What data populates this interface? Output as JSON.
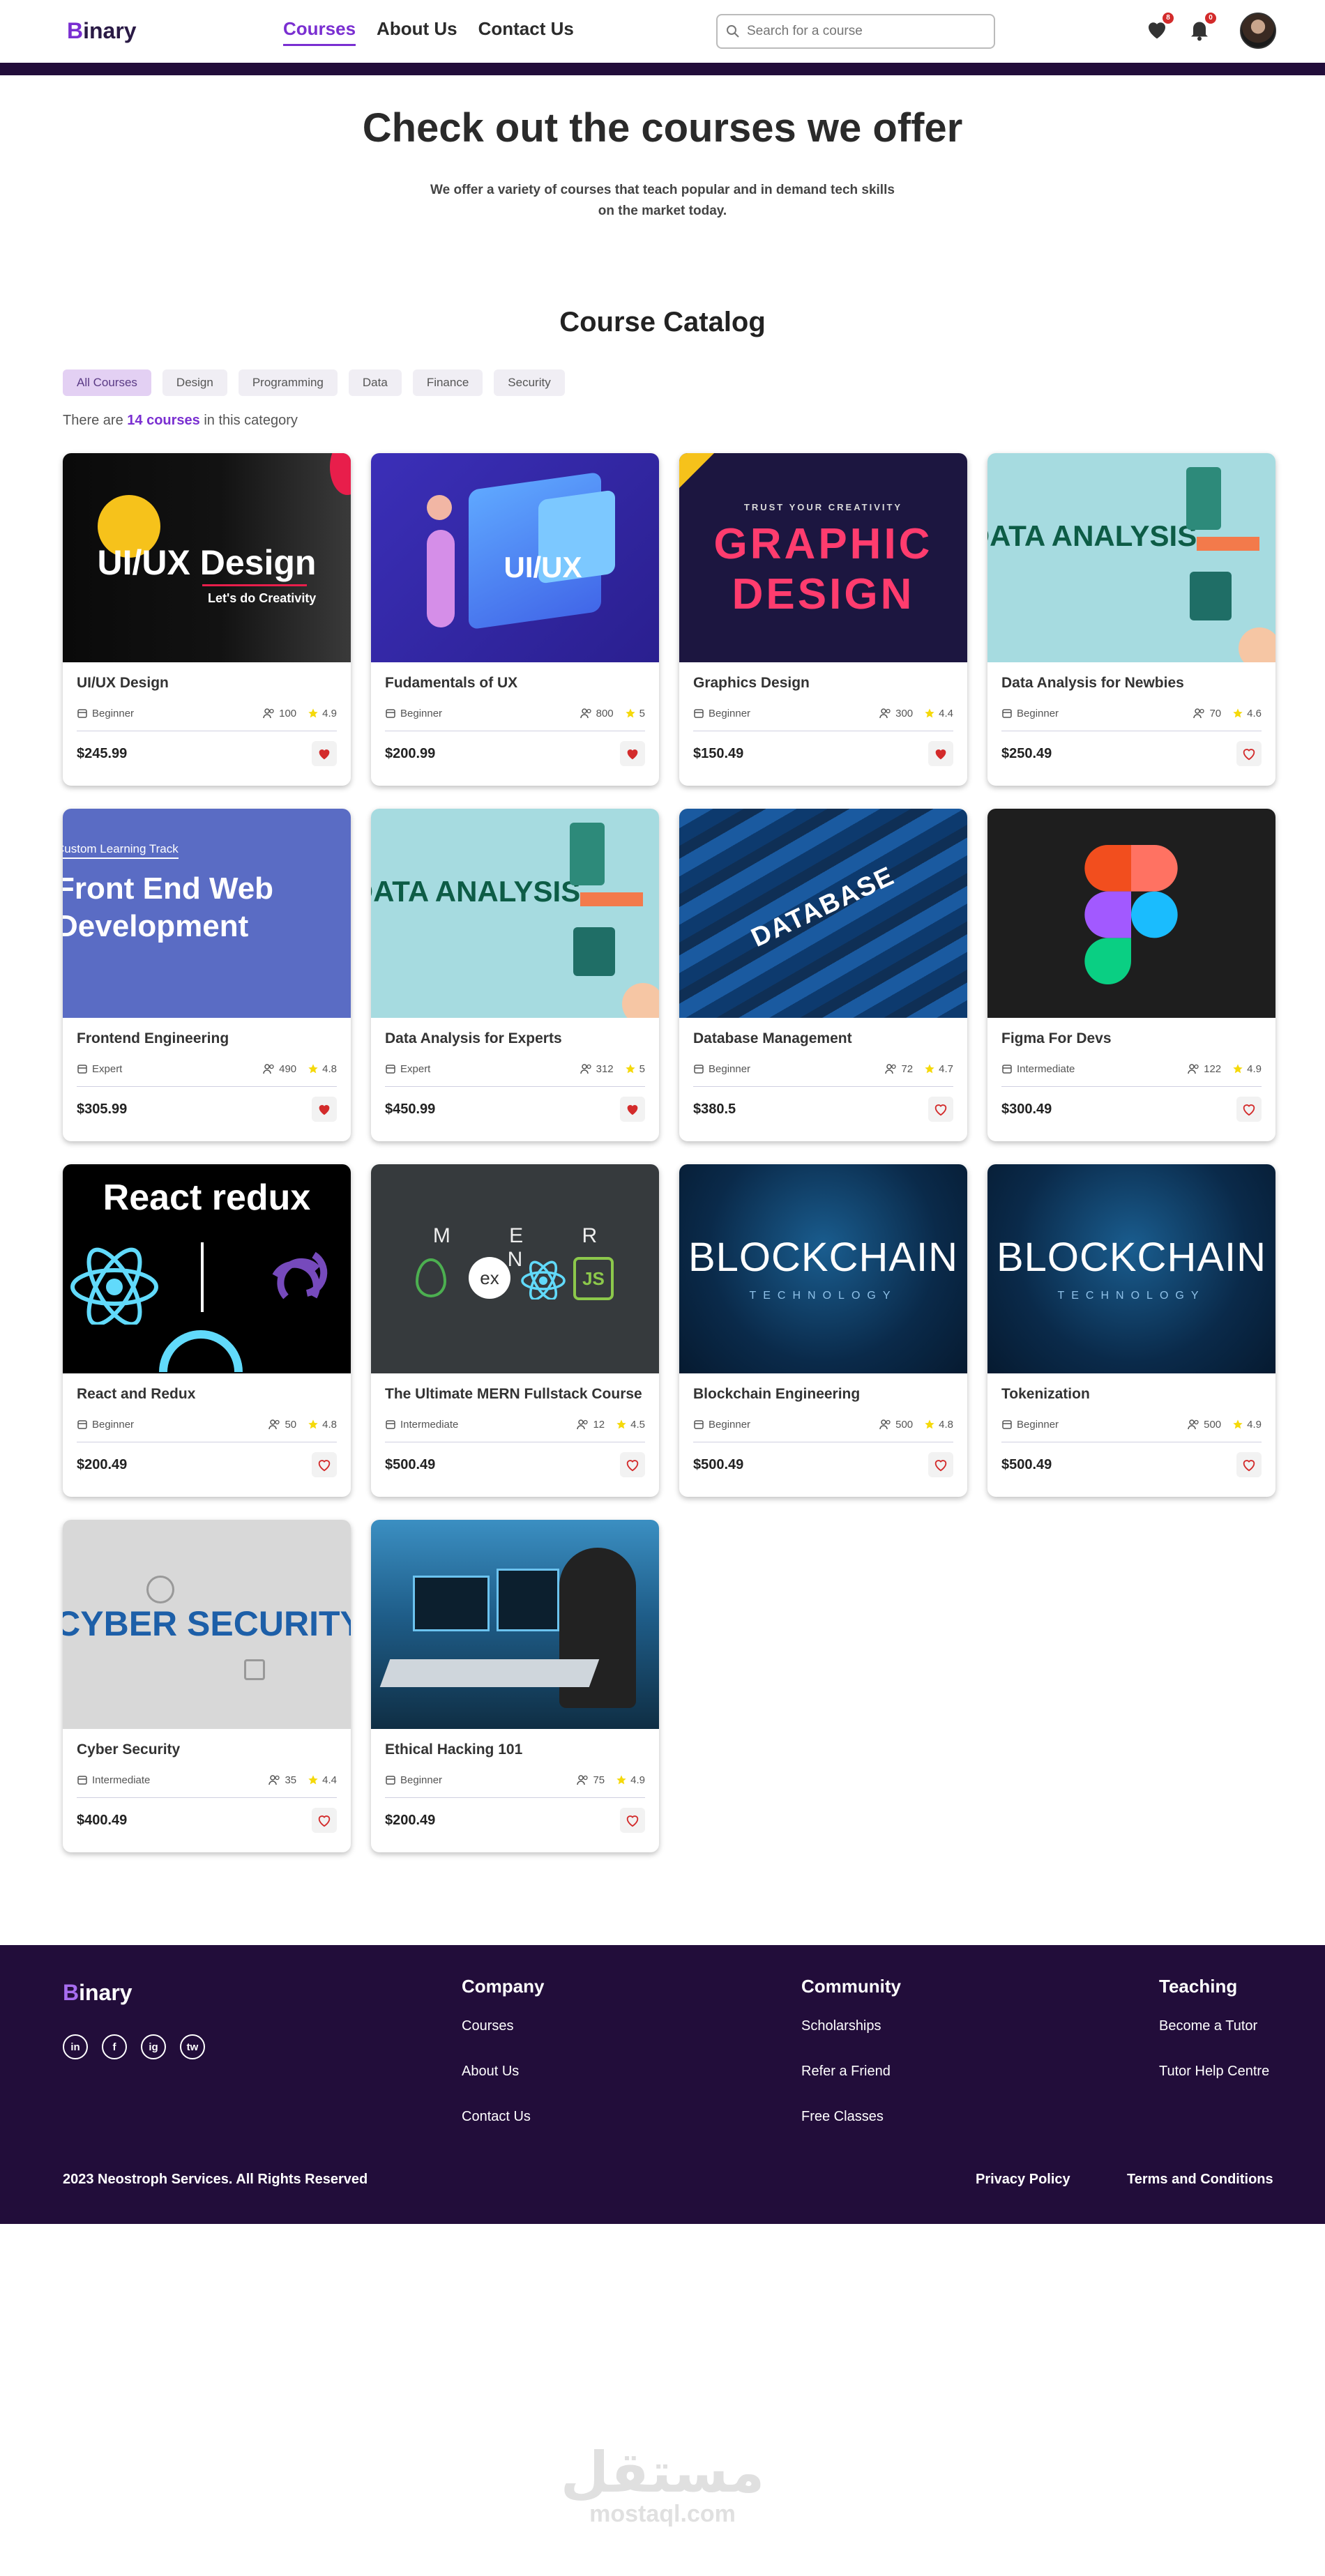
{
  "header": {
    "logo_initial": "B",
    "logo_rest": "inary",
    "nav": [
      {
        "label": "Courses",
        "active": true
      },
      {
        "label": "About Us",
        "active": false
      },
      {
        "label": "Contact Us",
        "active": false
      }
    ],
    "search_placeholder": "Search for a course",
    "wishlist_count": "8",
    "notification_count": "0"
  },
  "hero": {
    "title": "Check out the courses we offer",
    "subtitle": "We offer a variety of courses that teach popular and in demand tech skills on the market today."
  },
  "catalog": {
    "title": "Course Catalog",
    "filters": [
      "All Courses",
      "Design",
      "Programming",
      "Data",
      "Finance",
      "Security"
    ],
    "active_filter": "All Courses",
    "count_prefix": "There are ",
    "count_value": "14 courses",
    "count_suffix": " in this category"
  },
  "courses": [
    {
      "title": "UI/UX Design",
      "level": "Beginner",
      "students": "100",
      "rating": "4.9",
      "price": "$245.99",
      "favorited": true,
      "thumb_text": "UI/UX Design",
      "thumb_sub": "Let's do Creativity"
    },
    {
      "title": "Fudamentals of UX",
      "level": "Beginner",
      "students": "800",
      "rating": "5",
      "price": "$200.99",
      "favorited": true,
      "thumb_text": "UI/UX",
      "thumb_sub": ""
    },
    {
      "title": "Graphics Design",
      "level": "Beginner",
      "students": "300",
      "rating": "4.4",
      "price": "$150.49",
      "favorited": true,
      "thumb_text": "GRAPHIC DESIGN",
      "thumb_sub": "TRUST YOUR CREATIVITY"
    },
    {
      "title": "Data Analysis for Newbies",
      "level": "Beginner",
      "students": "70",
      "rating": "4.6",
      "price": "$250.49",
      "favorited": false,
      "thumb_text": "DATA ANALYSIS",
      "thumb_sub": ""
    },
    {
      "title": "Frontend Engineering",
      "level": "Expert",
      "students": "490",
      "rating": "4.8",
      "price": "$305.99",
      "favorited": true,
      "thumb_text": "Front End Web Development",
      "thumb_sub": "Custom Learning Track"
    },
    {
      "title": "Data Analysis for Experts",
      "level": "Expert",
      "students": "312",
      "rating": "5",
      "price": "$450.99",
      "favorited": true,
      "thumb_text": "DATA ANALYSIS",
      "thumb_sub": ""
    },
    {
      "title": "Database Management",
      "level": "Beginner",
      "students": "72",
      "rating": "4.7",
      "price": "$380.5",
      "favorited": false,
      "thumb_text": "DATABASE",
      "thumb_sub": ""
    },
    {
      "title": "Figma For Devs",
      "level": "Intermediate",
      "students": "122",
      "rating": "4.9",
      "price": "$300.49",
      "favorited": false,
      "thumb_text": "",
      "thumb_sub": ""
    },
    {
      "title": "React and Redux",
      "level": "Beginner",
      "students": "50",
      "rating": "4.8",
      "price": "$200.49",
      "favorited": false,
      "thumb_text": "React redux",
      "thumb_sub": ""
    },
    {
      "title": "The Ultimate MERN Fullstack Course",
      "level": "Intermediate",
      "students": "12",
      "rating": "4.5",
      "price": "$500.49",
      "favorited": false,
      "thumb_text": "M E R N",
      "thumb_sub": "ex"
    },
    {
      "title": "Blockchain Engineering",
      "level": "Beginner",
      "students": "500",
      "rating": "4.8",
      "price": "$500.49",
      "favorited": false,
      "thumb_text": "BLOCKCHAIN",
      "thumb_sub": "TECHNOLOGY"
    },
    {
      "title": "Tokenization",
      "level": "Beginner",
      "students": "500",
      "rating": "4.9",
      "price": "$500.49",
      "favorited": false,
      "thumb_text": "BLOCKCHAIN",
      "thumb_sub": "TECHNOLOGY"
    },
    {
      "title": "Cyber Security",
      "level": "Intermediate",
      "students": "35",
      "rating": "4.4",
      "price": "$400.49",
      "favorited": false,
      "thumb_text": "CYBER SECURITY",
      "thumb_sub": ""
    },
    {
      "title": "Ethical Hacking 101",
      "level": "Beginner",
      "students": "75",
      "rating": "4.9",
      "price": "$200.49",
      "favorited": false,
      "thumb_text": "",
      "thumb_sub": ""
    }
  ],
  "footer": {
    "logo_initial": "B",
    "logo_rest": "inary",
    "socials": [
      "in",
      "f",
      "ig",
      "tw"
    ],
    "company": {
      "heading": "Company",
      "links": [
        "Courses",
        "About Us",
        "Contact Us"
      ]
    },
    "community": {
      "heading": "Community",
      "links": [
        "Scholarships",
        "Refer a Friend",
        "Free Classes"
      ]
    },
    "teaching": {
      "heading": "Teaching",
      "links": [
        "Become a Tutor",
        "Tutor Help Centre"
      ]
    },
    "copyright": "2023 Neostroph Services. All Rights Reserved",
    "privacy": "Privacy Policy",
    "terms": "Terms and Conditions"
  },
  "watermark": {
    "arabic": "مستقل",
    "latin": "mostaql.com"
  },
  "colors": {
    "brand": "#7a2fd1",
    "dark": "#220d3a",
    "heart": "#d32b2b",
    "star": "#f5d90a"
  }
}
